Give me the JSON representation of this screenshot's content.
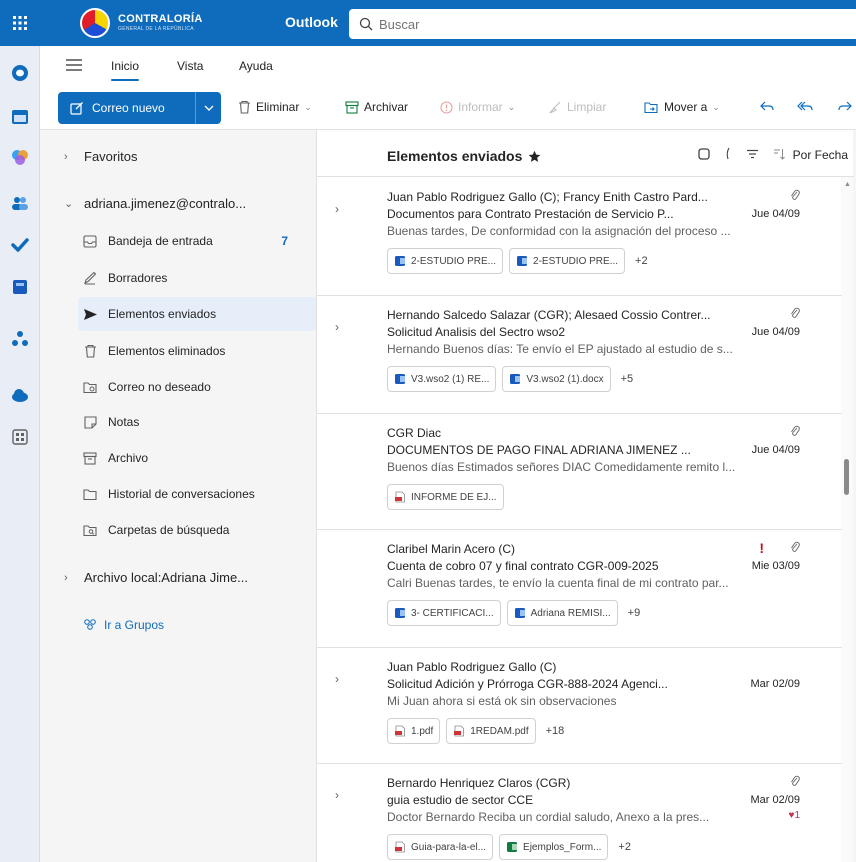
{
  "rail": {
    "apps": [
      "waffle-icon",
      "outlook-mail-icon",
      "calendar-icon",
      "copilot-icon",
      "people-icon",
      "todo-icon",
      "word-icon",
      "teams-icon",
      "onedrive-icon",
      "more-apps-icon"
    ]
  },
  "header": {
    "logo_text": "CONTRALORÍA",
    "logo_subtext": "GENERAL DE LA REPÚBLICA",
    "app_name": "Outlook",
    "search_placeholder": "Buscar"
  },
  "ribbon": {
    "tabs": [
      "Inicio",
      "Vista",
      "Ayuda"
    ],
    "active_tab": "Inicio"
  },
  "toolbar": {
    "new_mail_label": "Correo nuevo",
    "delete_label": "Eliminar",
    "archive_label": "Archivar",
    "report_label": "Informar",
    "sweep_label": "Limpiar",
    "move_label": "Mover a"
  },
  "folders": {
    "favorites_label": "Favoritos",
    "account_label": "adriana.jimenez@contralo...",
    "items": [
      {
        "label": "Bandeja de entrada",
        "count": "7",
        "icon": "inbox-icon"
      },
      {
        "label": "Borradores",
        "count": "",
        "icon": "drafts-icon"
      },
      {
        "label": "Elementos enviados",
        "count": "",
        "icon": "sent-icon"
      },
      {
        "label": "Elementos eliminados",
        "count": "",
        "icon": "trash-icon"
      },
      {
        "label": "Correo no deseado",
        "count": "",
        "icon": "junk-icon"
      },
      {
        "label": "Notas",
        "count": "",
        "icon": "notes-icon"
      },
      {
        "label": "Archivo",
        "count": "",
        "icon": "archive-icon"
      },
      {
        "label": "Historial de conversaciones",
        "count": "",
        "icon": "history-icon"
      },
      {
        "label": "Carpetas de búsqueda",
        "count": "",
        "icon": "search-folder-icon"
      }
    ],
    "selected_folder": "Elementos enviados",
    "local_archive_label": "Archivo local:Adriana Jime...",
    "groups_link": "Ir a Grupos"
  },
  "list": {
    "title": "Elementos enviados",
    "sort_label": "Por Fecha",
    "messages": [
      {
        "sender": "Juan Pablo Rodriguez Gallo (C); Francy Enith Castro Pard...",
        "subject": "Documentos para Contrato Prestación de Servicio P...",
        "date": "Jue 04/09",
        "preview": "Buenas tardes, De conformidad con la asignación del proceso ...",
        "attachments": [
          {
            "name": "2-ESTUDIO PRE...",
            "type": "word"
          },
          {
            "name": "2-ESTUDIO PRE...",
            "type": "word"
          }
        ],
        "more": "+2"
      },
      {
        "sender": "Hernando Salcedo Salazar (CGR); Alesaed Cossio Contrer...",
        "subject": "Solicitud Analisis del Sectro wso2",
        "date": "Jue 04/09",
        "preview": "Hernando Buenos días: Te envío el EP ajustado al estudio de s...",
        "attachments": [
          {
            "name": "V3.wso2 (1) RE...",
            "type": "word"
          },
          {
            "name": "V3.wso2 (1).docx",
            "type": "word"
          }
        ],
        "more": "+5"
      },
      {
        "sender": "CGR Diac",
        "subject": "DOCUMENTOS DE PAGO FINAL ADRIANA JIMENEZ ...",
        "date": "Jue 04/09",
        "preview": "Buenos días Estimados señores DIAC Comedidamente remito l...",
        "attachments": [
          {
            "name": "INFORME DE EJ...",
            "type": "pdf"
          }
        ],
        "more": ""
      },
      {
        "sender": "Claribel Marin Acero (C)",
        "subject": "Cuenta de cobro 07 y final contrato CGR-009-2025",
        "date": "Mie 03/09",
        "preview": "Calri Buenas tardes, te envío la cuenta final de mi contrato par...",
        "attachments": [
          {
            "name": "3- CERTIFICACI...",
            "type": "word"
          },
          {
            "name": "Adriana REMISI...",
            "type": "word"
          }
        ],
        "more": "+9"
      },
      {
        "sender": "Juan Pablo Rodriguez Gallo (C)",
        "subject": "Solicitud Adición y Prórroga CGR-888-2024 Agenci...",
        "date": "Mar 02/09",
        "preview": "Mi Juan ahora si está ok sin observaciones",
        "attachments": [
          {
            "name": "1.pdf",
            "type": "pdf"
          },
          {
            "name": "1REDAM.pdf",
            "type": "pdf"
          }
        ],
        "more": "+18"
      },
      {
        "sender": "Bernardo Henriquez Claros (CGR)",
        "subject": "guia estudio de sector CCE",
        "date": "Mar 02/09",
        "preview": "Doctor Bernardo Reciba un cordial saludo, Anexo a la pres...",
        "reaction": "1",
        "attachments": [
          {
            "name": "Guia-para-la-el...",
            "type": "pdf"
          },
          {
            "name": "Ejemplos_Form...",
            "type": "excel"
          }
        ],
        "more": "+2"
      }
    ]
  }
}
